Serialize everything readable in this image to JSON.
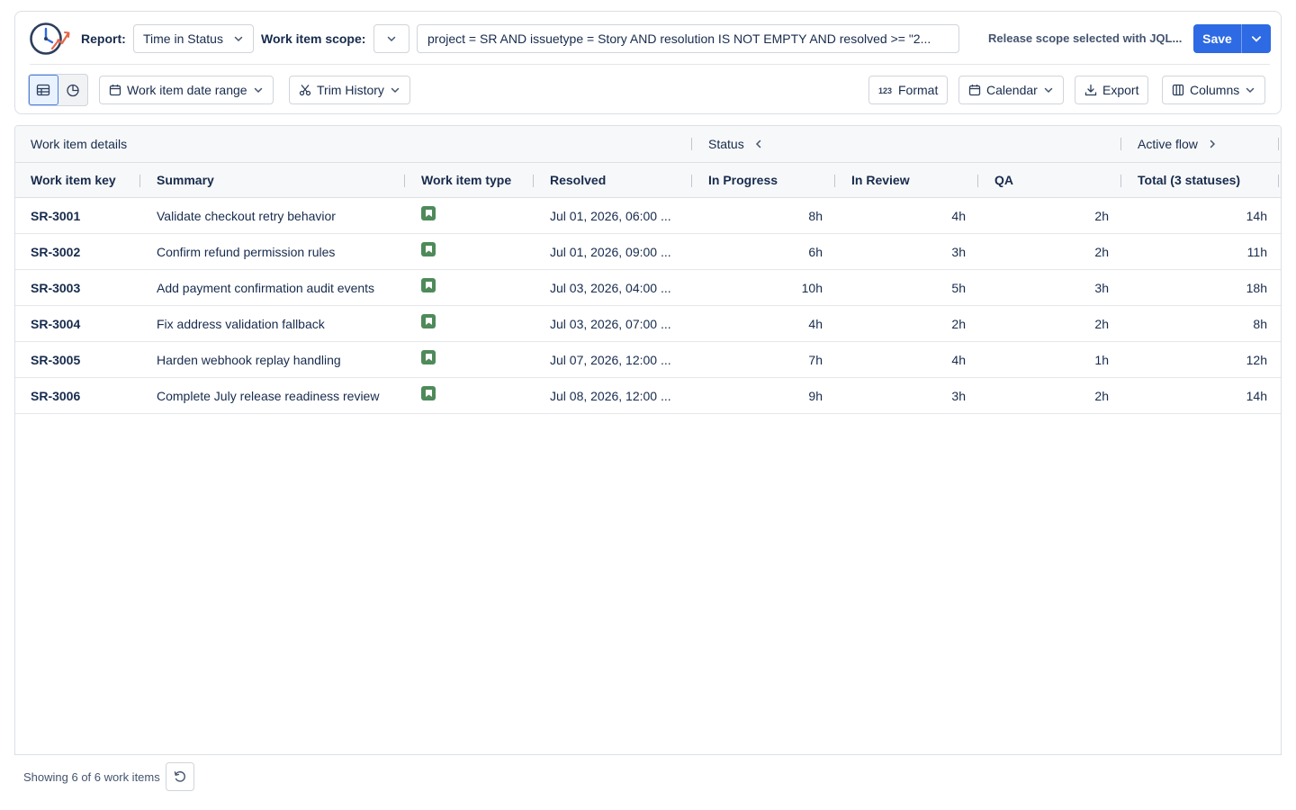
{
  "header": {
    "report_label": "Report:",
    "report_value": "Time in Status",
    "scope_label": "Work item scope:",
    "jql": "project = SR AND issuetype = Story AND resolution IS NOT EMPTY AND resolved >= \"2...",
    "scope_message": "Release scope selected with JQL...",
    "save_label": "Save"
  },
  "toolbar": {
    "date_range": "Work item date range",
    "trim_history": "Trim History",
    "format": "Format",
    "calendar": "Calendar",
    "export": "Export",
    "columns": "Columns"
  },
  "table": {
    "groups": {
      "details": "Work item details",
      "status": "Status",
      "active_flow": "Active flow"
    },
    "columns": [
      "Work item key",
      "Summary",
      "Work item type",
      "Resolved",
      "In Progress",
      "In Review",
      "QA",
      "Total (3 statuses)"
    ],
    "rows": [
      {
        "key": "SR-3001",
        "summary": "Validate checkout retry behavior",
        "resolved": "Jul 01, 2026, 06:00 ...",
        "in_progress": "8h",
        "in_review": "4h",
        "qa": "2h",
        "total": "14h"
      },
      {
        "key": "SR-3002",
        "summary": "Confirm refund permission rules",
        "resolved": "Jul 01, 2026, 09:00 ...",
        "in_progress": "6h",
        "in_review": "3h",
        "qa": "2h",
        "total": "11h"
      },
      {
        "key": "SR-3003",
        "summary": "Add payment confirmation audit events",
        "resolved": "Jul 03, 2026, 04:00 ...",
        "in_progress": "10h",
        "in_review": "5h",
        "qa": "3h",
        "total": "18h"
      },
      {
        "key": "SR-3004",
        "summary": "Fix address validation fallback",
        "resolved": "Jul 03, 2026, 07:00 ...",
        "in_progress": "4h",
        "in_review": "2h",
        "qa": "2h",
        "total": "8h"
      },
      {
        "key": "SR-3005",
        "summary": "Harden webhook replay handling",
        "resolved": "Jul 07, 2026, 12:00 ...",
        "in_progress": "7h",
        "in_review": "4h",
        "qa": "1h",
        "total": "12h"
      },
      {
        "key": "SR-3006",
        "summary": "Complete July release readiness review",
        "resolved": "Jul 08, 2026, 12:00 ...",
        "in_progress": "9h",
        "in_review": "3h",
        "qa": "2h",
        "total": "14h"
      }
    ]
  },
  "footer": {
    "showing": "Showing 6 of 6 work items"
  },
  "colors": {
    "primary": "#2d6ae3",
    "story": "#4e8a5a",
    "text": "#172b4d"
  }
}
